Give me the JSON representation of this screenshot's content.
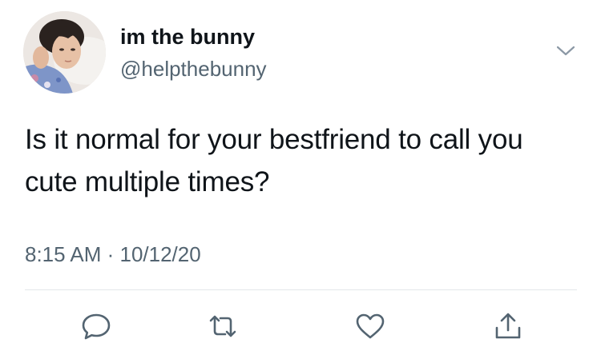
{
  "tweet": {
    "author": {
      "display_name": "im the bunny",
      "handle": "@helpthebunny"
    },
    "text": "Is it normal for your bestfriend to call you cute multiple times?",
    "timestamp": "8:15 AM · 10/12/20"
  },
  "icons": {
    "more": "chevron-down-icon",
    "reply": "reply-icon",
    "retweet": "retweet-icon",
    "like": "heart-icon",
    "share": "share-icon"
  },
  "colors": {
    "primary_text": "#0f1419",
    "secondary_text": "#536471",
    "icon": "#536471",
    "divider": "#e3e7ea"
  }
}
